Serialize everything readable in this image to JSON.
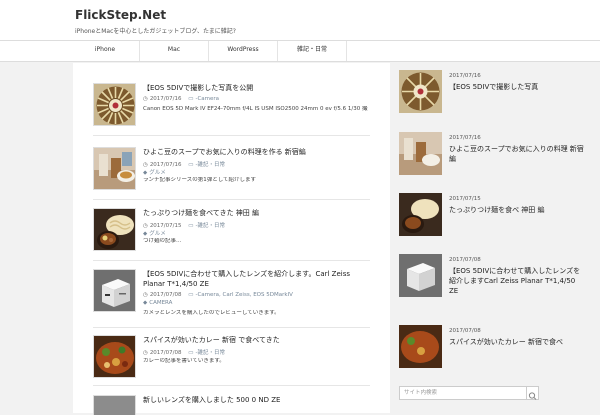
{
  "site": {
    "title": "FlickStep.Net",
    "description": "iPhoneとMacを中心としたガジェットブログ、たまに雑記?"
  },
  "nav": {
    "items": [
      {
        "label": "iPhone"
      },
      {
        "label": "Mac"
      },
      {
        "label": "WordPress"
      },
      {
        "label": "雑記・日常"
      }
    ]
  },
  "posts": [
    {
      "title": "【EOS 5DIVで撮影した写真を公開",
      "date": "2017/07/16",
      "category": "-Camera",
      "tags": "",
      "excerpt": "Canon EOS 5D Mark IV EF24-70mm f/4L IS USM ISO2500 24mm 0 ev f/5.6 1/30 撮影した写真をここで…"
    },
    {
      "title": "ひよこ豆のスープでお気に入りの料理を作る 新宿編",
      "date": "2017/07/16",
      "category": "-雑記・日常",
      "tags": "グルメ",
      "excerpt": "ランチ記事シリーズの第1弾として紹介します"
    },
    {
      "title": "たっぷりつけ麺を食べてきた 神田 編",
      "date": "2017/07/15",
      "category": "-雑記・日常",
      "tags": "グルメ",
      "excerpt": "つけ麺の記事…"
    },
    {
      "title": "【EOS 5DIVに合わせて購入したレンズを紹介します。Carl Zeiss Planar T*1,4/50 ZE",
      "date": "2017/07/08",
      "category": "-Camera, Carl Zeiss, EOS 5DMarkIV",
      "tags": "CAMERA",
      "excerpt": "カメラとレンズを購入したのでレビューしていきます。"
    },
    {
      "title": "スパイスが効いたカレー 新宿 で食べてきた",
      "date": "2017/07/08",
      "category": "-雑記・日常",
      "tags": "",
      "excerpt": "カレーの記事を書いていきます。"
    },
    {
      "title": "新しいレンズを購入しました 500 0 ND ZE",
      "date": "",
      "category": "",
      "tags": "",
      "excerpt": ""
    }
  ],
  "sidebar": {
    "items": [
      {
        "date": "2017/07/16",
        "title": "【EOS 5DIVで撮影した写真"
      },
      {
        "date": "2017/07/16",
        "title": "ひよこ豆のスープでお気に入りの料理 新宿編"
      },
      {
        "date": "2017/07/15",
        "title": "たっぷりつけ麺を食べ 神田 編"
      },
      {
        "date": "2017/07/08",
        "title": "【EOS 5DIVに合わせて購入したレンズを紹介しますCarl Zeiss Planar T*1,4/50 ZE"
      },
      {
        "date": "2017/07/08",
        "title": "スパイスが効いたカレー 新宿で食べ"
      }
    ],
    "search_placeholder": "サイト内検索"
  },
  "colors": {
    "link_meta": "#778899",
    "background": "#f2f2f2"
  }
}
